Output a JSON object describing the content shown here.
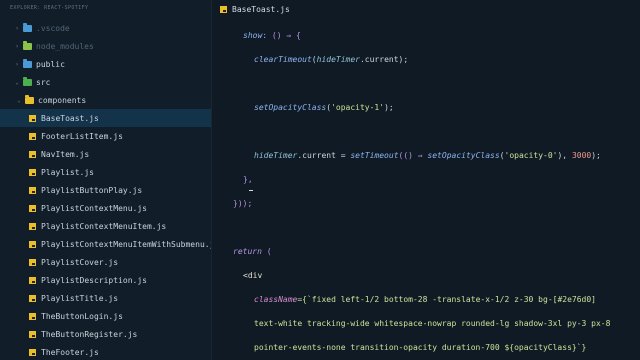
{
  "sidebar": {
    "header": "EXPLORER: REACT-SPOTIFY",
    "items": [
      {
        "label": ".vscode",
        "type": "folder",
        "chevron": "›",
        "color": "#4a9ad8",
        "dim": true
      },
      {
        "label": "node_modules",
        "type": "folder",
        "chevron": "›",
        "color": "#8bc34a",
        "dim": true
      },
      {
        "label": "public",
        "type": "folder",
        "chevron": "›",
        "color": "#4a9ad8",
        "dim": false
      },
      {
        "label": "src",
        "type": "folder",
        "chevron": "⌄",
        "color": "#4caf50",
        "dim": false
      },
      {
        "label": "components",
        "type": "folder",
        "chevron": "⌄",
        "color": "#e9bf2b",
        "dim": false
      },
      {
        "label": "BaseToast.js",
        "type": "file",
        "selected": true
      },
      {
        "label": "FooterListItem.js",
        "type": "file"
      },
      {
        "label": "NavItem.js",
        "type": "file"
      },
      {
        "label": "Playlist.js",
        "type": "file"
      },
      {
        "label": "PlaylistButtonPlay.js",
        "type": "file"
      },
      {
        "label": "PlaylistContextMenu.js",
        "type": "file"
      },
      {
        "label": "PlaylistContextMenuItem.js",
        "type": "file"
      },
      {
        "label": "PlaylistContextMenuItemWithSubmenu.js",
        "type": "file"
      },
      {
        "label": "PlaylistCover.js",
        "type": "file"
      },
      {
        "label": "PlaylistDescription.js",
        "type": "file"
      },
      {
        "label": "PlaylistTitle.js",
        "type": "file"
      },
      {
        "label": "TheButtonLogin.js",
        "type": "file"
      },
      {
        "label": "TheButtonRegister.js",
        "type": "file"
      },
      {
        "label": "TheFooter.js",
        "type": "file"
      }
    ]
  },
  "editor": {
    "tab_label": "BaseToast.js",
    "code": {
      "l1_show": "show",
      "l1_rest": ": () ⇒ {",
      "l2_fn": "clearTimeout",
      "l2_open": "(",
      "l2_var": "hideTimer",
      "l2_rest": ".current);",
      "l3_fn": "setOpacityClass",
      "l3_open": "(",
      "l3_str": "'opacity-1'",
      "l3_close": ");",
      "l4_var": "hideTimer",
      "l4_mid": ".current = ",
      "l4_fn": "setTimeout",
      "l4_p1": "(() ⇒ ",
      "l4_fn2": "setOpacityClass",
      "l4_p2": "(",
      "l4_str": "'opacity-0'",
      "l4_p3": "), ",
      "l4_num": "3000",
      "l4_end": ");",
      "l5": "},",
      "l6": "}));",
      "l7_kw": "return",
      "l7_rest": " (",
      "l8": "<div",
      "l9_attr": "className",
      "l9_rest": "={`fixed left-1/2 bottom-28 -translate-x-1/2 z-30 bg-[#2e76d0]",
      "l10": "text-white tracking-wide whitespace-nowrap rounded-lg shadow-3xl py-3 px-8",
      "l11": "pointer-events-none transition-opacity duration-700 ${opacityClass}`}"
    }
  }
}
